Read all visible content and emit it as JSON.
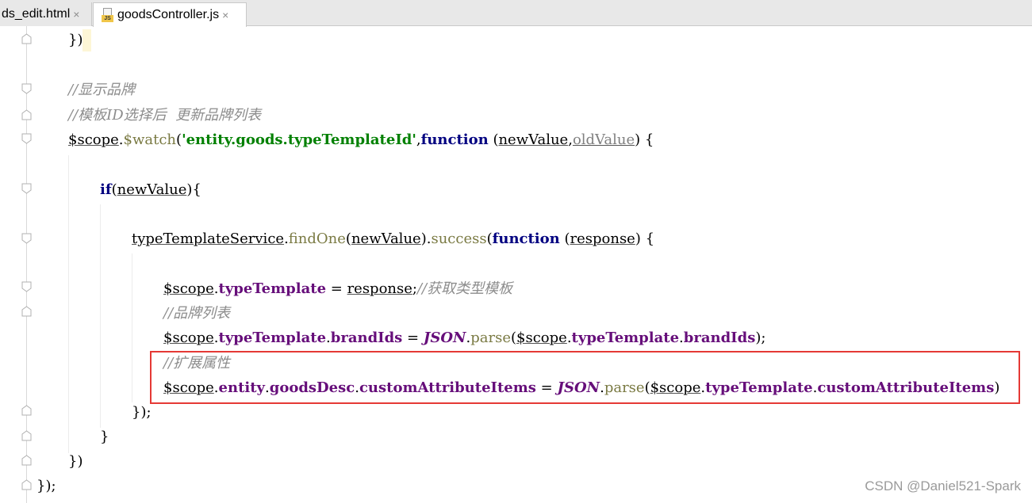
{
  "tabs": [
    {
      "label": "ds_edit.html",
      "close": "×"
    },
    {
      "label": "goodsController.js",
      "close": "×",
      "icon": "js-file-icon",
      "icon_text": "JS"
    }
  ],
  "code": {
    "l1": "})",
    "l3": "//显示品牌",
    "l4": "//模板ID选择后  更新品牌列表",
    "l5": {
      "scope": "$scope",
      "dot": ".",
      "watch": "$watch",
      "op": "(",
      "str": "'entity.goods.typeTemplateId'",
      "comma": ",",
      "fn": "function",
      "sp": " ",
      "op2": "(",
      "a": "newValue",
      "c2": ",",
      "b": "oldValue",
      "cl": ")",
      "br": " {"
    },
    "l7": {
      "kw": "if",
      "op": "(",
      "arg": "newValue",
      "cl": "){"
    },
    "l9": {
      "svc": "typeTemplateService",
      "dot": ".",
      "find": "findOne",
      "op": "(",
      "arg": "newValue",
      "cl": ")",
      "dot2": ".",
      "succ": "success",
      "op2": "(",
      "fn": "function",
      "sp": " ",
      "op3": "(",
      "resp": "response",
      "cl2": ")",
      "br": " {"
    },
    "l11": {
      "scope": "$scope",
      "dot": ".",
      "fld": "typeTemplate",
      "eq": " = ",
      "resp": "response",
      "semi": ";",
      "cm": "//获取类型模板"
    },
    "l12": "//品牌列表",
    "l13": {
      "scope": "$scope",
      "dot": ".",
      "fld": "typeTemplate",
      "dot2": ".",
      "fld2": "brandIds",
      "eq": " = ",
      "json": "JSON",
      "dot3": ".",
      "parse": "parse",
      "op": "(",
      "scope2": "$scope",
      "dot4": ".",
      "fld3": "typeTemplate",
      "dot5": ".",
      "fld4": "brandIds",
      "cl": ");"
    },
    "l14": "//扩展属性",
    "l15": {
      "scope": "$scope",
      "dot": ".",
      "fld": "entity",
      "dot2": ".",
      "fld2": "goodsDesc",
      "dot3": ".",
      "fld3": "customAttributeItems",
      "eq": " = ",
      "json": "JSON",
      "dot4": ".",
      "parse": "parse",
      "op": "(",
      "scope2": "$scope",
      "dot5": ".",
      "fld4": "typeTemplate",
      "dot6": ".",
      "fld5": "customAttributeItems",
      "cl": ")"
    },
    "l16": "});",
    "l17": "}",
    "l18": "})",
    "l19": "});"
  },
  "watermark": "CSDN @Daniel521-Spark",
  "colors": {
    "comment": "#8c8c8c",
    "field": "#660e7a",
    "string": "#008000",
    "keyword": "#000080",
    "method": "#7a7a43",
    "highlight": "#e53935"
  }
}
